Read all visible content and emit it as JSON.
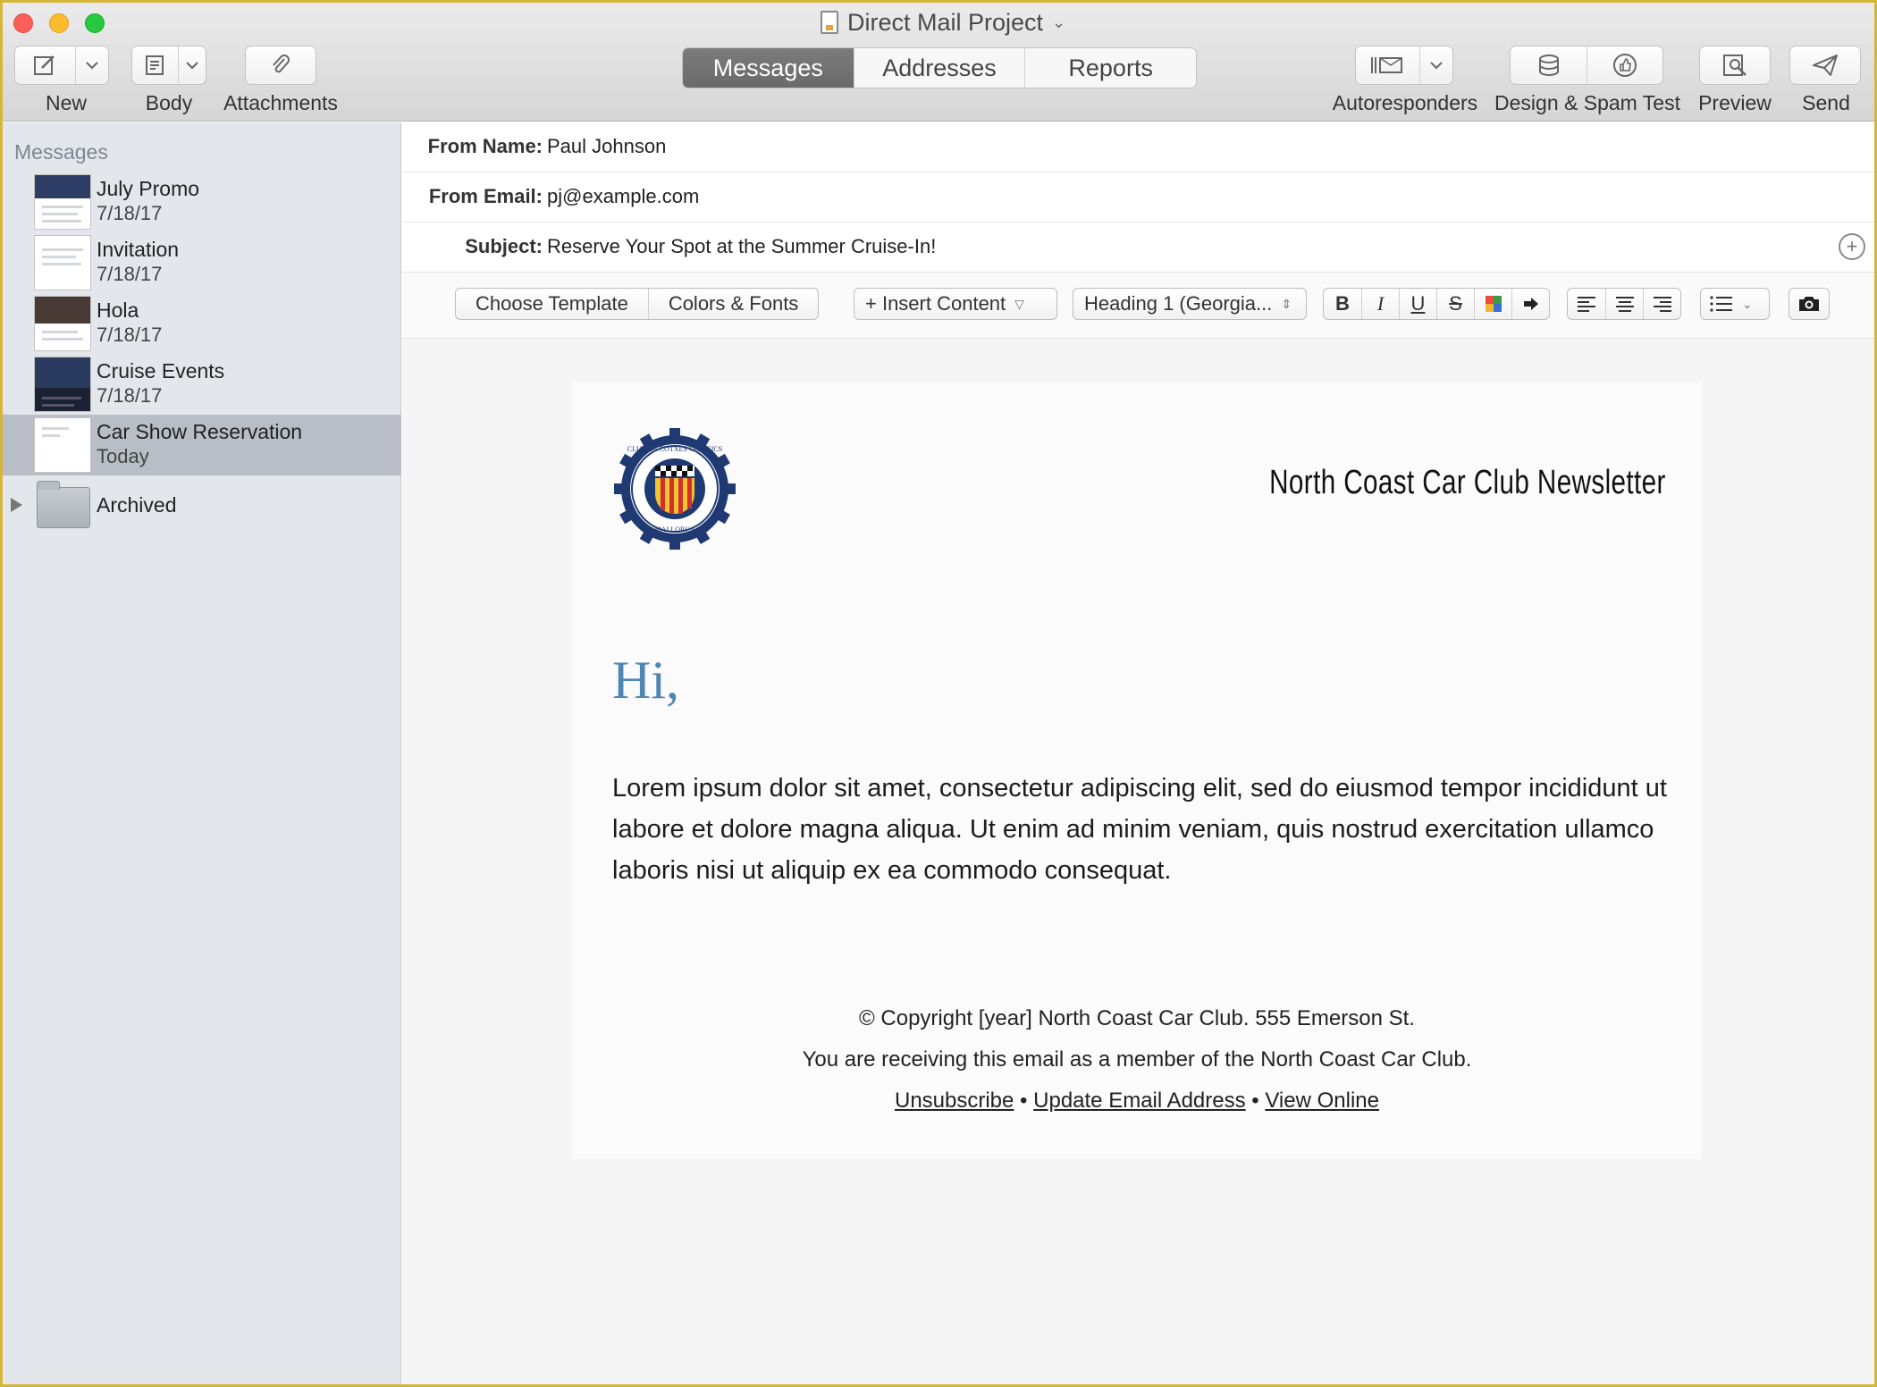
{
  "window": {
    "title": "Direct Mail Project",
    "title_icon": "document-icon"
  },
  "toolbar": {
    "new_label": "New",
    "body_label": "Body",
    "attachments_label": "Attachments",
    "tabs": [
      {
        "label": "Messages",
        "active": true
      },
      {
        "label": "Addresses",
        "active": false
      },
      {
        "label": "Reports",
        "active": false
      }
    ],
    "autoresponders_label": "Autoresponders",
    "design_spam_label": "Design & Spam Test",
    "preview_label": "Preview",
    "send_label": "Send"
  },
  "sidebar": {
    "heading": "Messages",
    "items": [
      {
        "name": "July Promo",
        "date": "7/18/17",
        "selected": false
      },
      {
        "name": "Invitation",
        "date": "7/18/17",
        "selected": false
      },
      {
        "name": "Hola",
        "date": "7/18/17",
        "selected": false
      },
      {
        "name": "Cruise Events",
        "date": "7/18/17",
        "selected": false
      },
      {
        "name": "Car Show Reservation",
        "date": "Today",
        "selected": true
      }
    ],
    "folder": {
      "name": "Archived",
      "expanded": false
    }
  },
  "header_fields": {
    "from_name_label": "From Name:",
    "from_name_value": "Paul Johnson",
    "from_email_label": "From Email:",
    "from_email_value": "pj@example.com",
    "subject_label": "Subject:",
    "subject_value": "Reserve Your Spot at the Summer Cruise-In!"
  },
  "format_bar": {
    "choose_template": "Choose Template",
    "colors_fonts": "Colors & Fonts",
    "insert_content": "+ Insert Content",
    "style_select": "Heading 1 (Georgia..."
  },
  "email": {
    "newsletter_title": "North Coast Car Club Newsletter",
    "logo": {
      "ring_text_top": "CLUB DE COTXES CLÀSSICS",
      "ring_text_bottom": "MALLORCA"
    },
    "greeting": "Hi,",
    "body": "Lorem ipsum dolor sit amet, consectetur adipiscing elit, sed do eiusmod tempor incididunt ut labore et dolore magna aliqua. Ut enim ad minim veniam, quis nostrud exercitation ullamco laboris nisi ut aliquip ex ea commodo consequat.",
    "footer_line1": "© Copyright [year] North Coast Car Club. 555 Emerson St.",
    "footer_line2": "You are receiving this email as a member of the North Coast Car Club.",
    "links": {
      "unsubscribe": "Unsubscribe",
      "update": "Update Email Address",
      "view_online": "View Online",
      "separator": " • "
    }
  },
  "colors": {
    "greeting": "#4f86b4",
    "selected_row": "#b8bdc6",
    "sidebar_bg": "#e3e6ea",
    "frame": "#d4b73a"
  }
}
